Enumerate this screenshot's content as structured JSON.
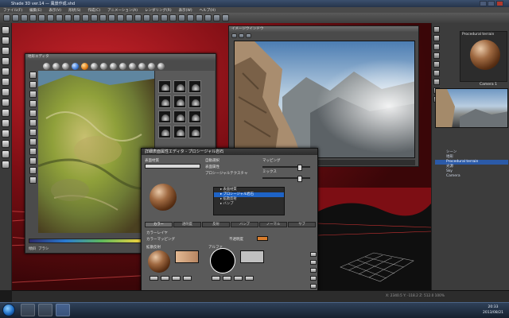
{
  "titlebar": {
    "title": "Shade 3D ver.14 — 風景作成.shd"
  },
  "menubar": {
    "items": [
      "ファイル(F)",
      "編集(E)",
      "表示(V)",
      "形状(S)",
      "作成(C)",
      "アニメーション(A)",
      "レンダリング(R)",
      "表示(W)",
      "ヘルプ(H)"
    ]
  },
  "terrain_window": {
    "title": "地形エディタ",
    "bottom_label": "傾斜",
    "bottom_label2": "ブラシ"
  },
  "render_window": {
    "title": "イメージウインドウ",
    "status": "レンダリング時間 00:00:12"
  },
  "right_panel": {
    "preview_label": "Procedural terrain",
    "camera_label": "Camera 1",
    "tree": [
      {
        "label": "シーン",
        "selected": false
      },
      {
        "label": "地形",
        "selected": false
      },
      {
        "label": "Procedural terrain",
        "selected": true
      },
      {
        "label": "光源",
        "selected": false
      },
      {
        "label": "Sky",
        "selected": false
      },
      {
        "label": "Camera",
        "selected": false
      }
    ]
  },
  "material_dialog": {
    "title": "詳細表面属性エディタ - プロシージャル岩石",
    "tree": [
      {
        "label": "▸ 表面材質",
        "selected": false
      },
      {
        "label": "▸ プロシージャル岩石",
        "selected": true
      },
      {
        "label": "  ▸ 拡散反射",
        "selected": false
      },
      {
        "label": "  ▸ バンプ",
        "selected": false
      }
    ],
    "labels": {
      "type": "表面材質",
      "mode": "マッピング",
      "mix": "ミックス",
      "color": "カラーレイヤ",
      "color_mapping": "カラーマッピング",
      "diffuse": "拡散反射",
      "alpha": "アルファ",
      "bump": "バンプ",
      "opacity": "不透明度",
      "option1": "自動選択",
      "option2": "表面属性",
      "option3": "プロシージャルテクスチャ"
    },
    "tabs": [
      "カラー",
      "透明度",
      "反射",
      "バンプ",
      "ノーマル",
      "サブ"
    ]
  },
  "statusbar": {
    "text": "X: 2340.5  Y: -118.2  Z: 512.0   100%"
  },
  "clock": {
    "time": "20:33",
    "date": "2013/08/21"
  },
  "colors": {
    "accent": "#1e63c6",
    "terrain_red": "#c7232a"
  }
}
